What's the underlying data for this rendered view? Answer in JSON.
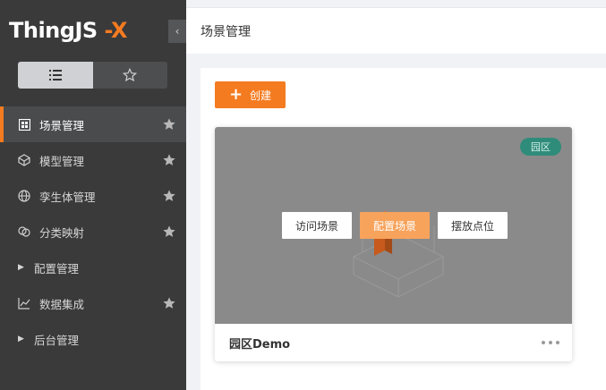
{
  "app": {
    "logo_main": "ThingJS",
    "logo_suffix": "-X"
  },
  "sidebar": {
    "view_toggle": {
      "list_icon": "list-icon",
      "star_icon": "star-icon"
    },
    "items": [
      {
        "label": "场景管理",
        "icon": "scene-icon",
        "starred": true,
        "active": true
      },
      {
        "label": "模型管理",
        "icon": "model-icon",
        "starred": true,
        "active": false
      },
      {
        "label": "孪生体管理",
        "icon": "globe-icon",
        "starred": true,
        "active": false
      },
      {
        "label": "分类映射",
        "icon": "mapping-icon",
        "starred": true,
        "active": false
      },
      {
        "label": "配置管理",
        "icon": "caret-right-icon",
        "starred": false,
        "active": false
      },
      {
        "label": "数据集成",
        "icon": "chart-icon",
        "starred": true,
        "active": false
      },
      {
        "label": "后台管理",
        "icon": "caret-right-icon",
        "starred": false,
        "active": false
      }
    ]
  },
  "header": {
    "title": "场景管理"
  },
  "main": {
    "create_label": "创建",
    "card": {
      "badge": "园区",
      "name": "园区Demo",
      "actions": [
        "访问场景",
        "配置场景",
        "摆放点位"
      ]
    }
  },
  "colors": {
    "accent": "#f47b20",
    "sidebar_bg": "#3a3a3b",
    "badge_bg": "#2f8c7a"
  }
}
